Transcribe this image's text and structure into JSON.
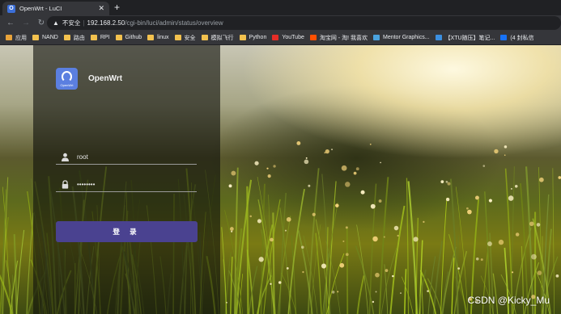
{
  "tab": {
    "title": "OpenWrt - LuCI",
    "favicon": "openwrt-logo-icon"
  },
  "omnibox": {
    "security_text": "不安全",
    "url_host": "192.168.2.50",
    "url_path": "/cgi-bin/luci/admin/status/overview"
  },
  "bookmarks": [
    {
      "label": "应用",
      "icon": "apps-grid-icon",
      "color": "#e8a33a"
    },
    {
      "label": "NAND",
      "icon": "folder-icon",
      "color": "#f2c14e"
    },
    {
      "label": "路由",
      "icon": "folder-icon",
      "color": "#f2c14e"
    },
    {
      "label": "RPI",
      "icon": "folder-icon",
      "color": "#f2c14e"
    },
    {
      "label": "Github",
      "icon": "folder-icon",
      "color": "#f2c14e"
    },
    {
      "label": "linux",
      "icon": "folder-icon",
      "color": "#f2c14e"
    },
    {
      "label": "安全",
      "icon": "folder-icon",
      "color": "#f2c14e"
    },
    {
      "label": "模拟飞行",
      "icon": "folder-icon",
      "color": "#f2c14e"
    },
    {
      "label": "Python",
      "icon": "folder-icon",
      "color": "#f2c14e"
    },
    {
      "label": "YouTube",
      "icon": "youtube-icon",
      "color": "#e52d27"
    },
    {
      "label": "淘宝网 - 淘! 我喜欢",
      "icon": "taobao-icon",
      "color": "#ff5000"
    },
    {
      "label": "Mentor Graphics...",
      "icon": "mentor-icon",
      "color": "#4aa3df"
    },
    {
      "label": "【XTU随压】笔记...",
      "icon": "note-icon",
      "color": "#3b8fe0"
    },
    {
      "label": "(4 封私信",
      "icon": "zhihu-icon",
      "color": "#1772f6"
    }
  ],
  "login": {
    "brand": "OpenWrt",
    "logo_caption": "OpenWrt",
    "username": "root",
    "password": "••••••••",
    "submit": "登 录"
  },
  "watermark": "CSDN @Kicky_Mu",
  "colors": {
    "accent": "#4a4290",
    "logo": "#5b7fe0"
  }
}
